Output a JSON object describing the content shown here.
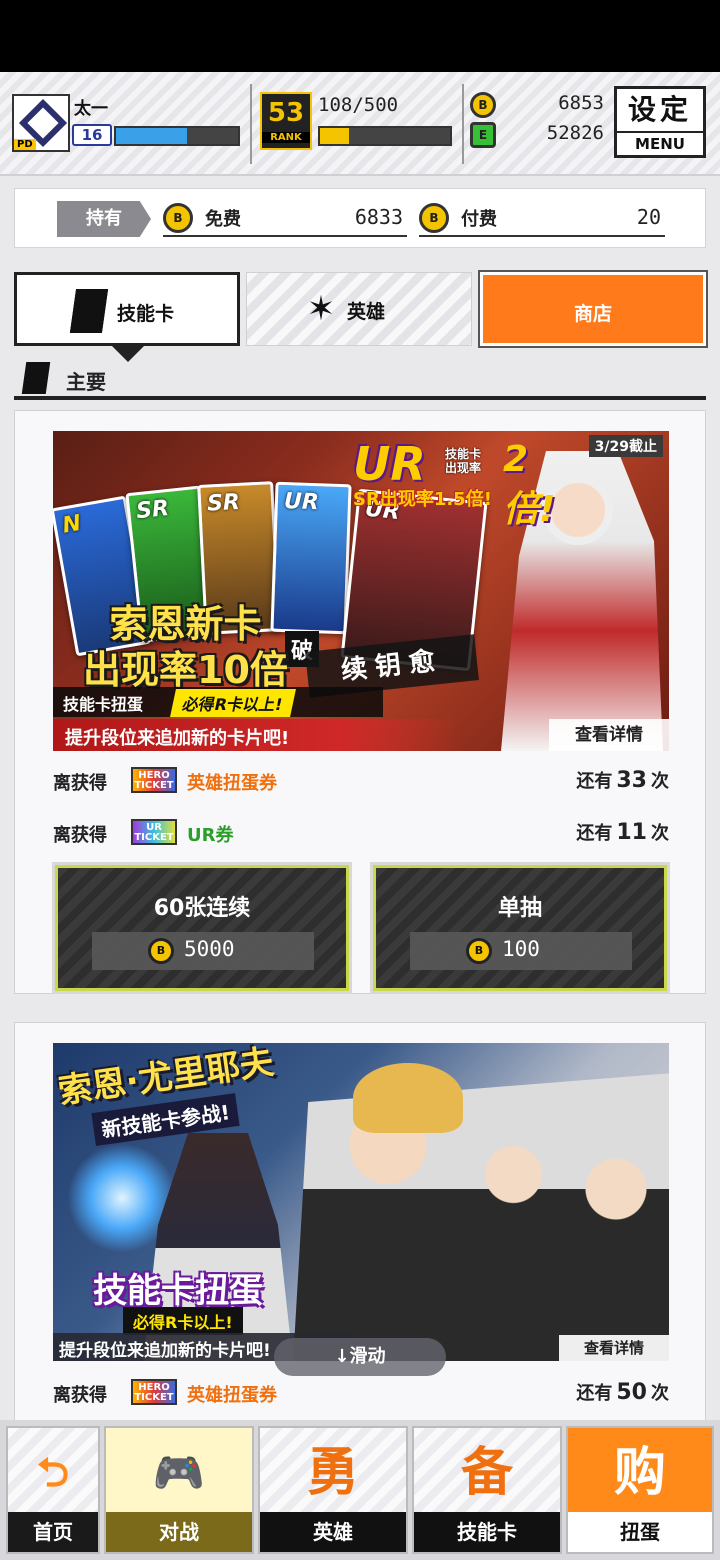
{
  "player": {
    "avatar_badge": "PD",
    "name": "太一",
    "level": "16",
    "rank_number": "53",
    "rank_label": "RANK",
    "rank_progress": "108/500",
    "coin_icon": "B",
    "coins": "6853",
    "gem_icon": "E",
    "gems": "52826",
    "level_progress": 0.58,
    "rank_progress_fraction": 0.22
  },
  "menu": {
    "label_cn": "设定",
    "label_en": "MENU"
  },
  "holdings": {
    "label": "持有",
    "free_label": "免费",
    "free_value": "6833",
    "paid_label": "付费",
    "paid_value": "20"
  },
  "tabs": {
    "skill": "技能卡",
    "hero": "英雄",
    "shop": "商店"
  },
  "section_title": "主要",
  "banner1": {
    "deadline": "3/29截止",
    "ur": "UR",
    "ur_sub_1": "技能卡",
    "ur_sub_2": "出现率",
    "ur_x2": "2倍!",
    "sr_line": "SR出现率1.5倍!",
    "card_ranks": [
      "N",
      "SR",
      "SR",
      "UR",
      "UR"
    ],
    "title_line1": "索恩新卡",
    "title_line2": "出现率10倍",
    "chip_a": "技能卡扭蛋",
    "chip_b": "必得R卡以上!",
    "stamp_small": "破",
    "stamp": "续钥愈",
    "promo": "提升段位来追加新的卡片吧!",
    "detail": "查看详情"
  },
  "progress1": [
    {
      "prefix": "离获得",
      "ticket": "HERO TICKET",
      "name": "英雄扭蛋券",
      "remain_pre": "还有",
      "count": "33",
      "remain_post": "次"
    },
    {
      "prefix": "离获得",
      "ticket": "UR TICKET",
      "name": "UR券",
      "remain_pre": "还有",
      "count": "11",
      "remain_post": "次"
    }
  ],
  "gacha": {
    "multi_label": "60张连续",
    "multi_cost": "5000",
    "single_label": "单抽",
    "single_cost": "100"
  },
  "banner2": {
    "title": "索恩·尤里耶夫",
    "subtitle": "新技能卡参战!",
    "main": "技能卡扭蛋",
    "chip": "必得R卡以上!",
    "promo": "提升段位来追加新的卡片吧!",
    "detail": "查看详情"
  },
  "swipe_hint": "↓滑动",
  "progress2": {
    "prefix": "离获得",
    "ticket": "HERO TICKET",
    "name": "英雄扭蛋券",
    "remain_pre": "还有",
    "count": "50",
    "remain_post": "次"
  },
  "bottom_nav": [
    {
      "icon": "back-arrow-icon",
      "glyph": "⮌",
      "label": "首页"
    },
    {
      "icon": "gamepad-icon",
      "glyph": "🎮",
      "label": "对战"
    },
    {
      "icon": "hero-icon",
      "glyph": "勇",
      "label": "英雄"
    },
    {
      "icon": "card-icon",
      "glyph": "备",
      "label": "技能卡"
    },
    {
      "icon": "gacha-icon",
      "glyph": "购",
      "label": "扭蛋"
    }
  ],
  "colors": {
    "accent": "#ff7a1a",
    "coin": "#f5c400",
    "xp": "#3aa0e8",
    "btn_border": "#c9d84a"
  }
}
